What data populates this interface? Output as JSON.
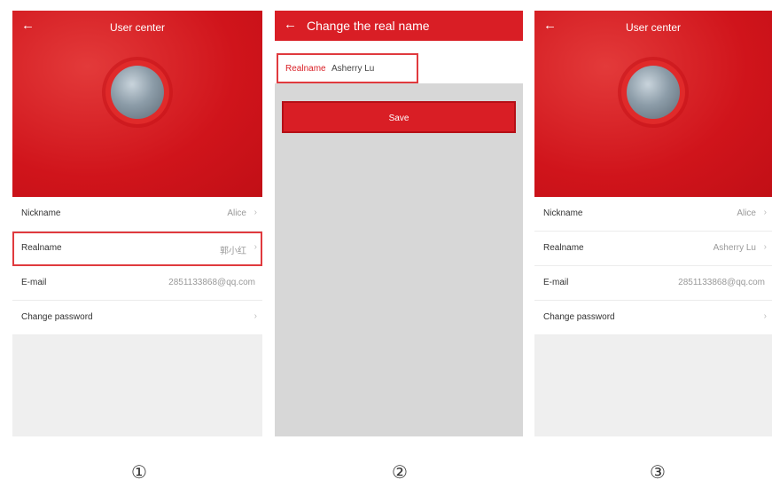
{
  "screen1": {
    "title": "User center",
    "rows": [
      {
        "label": "Nickname",
        "value": "Alice"
      },
      {
        "label": "Realname",
        "value": "郭小红"
      },
      {
        "label": "E-mail",
        "value": "2851133868@qq.com"
      },
      {
        "label": "Change password",
        "value": ""
      }
    ]
  },
  "screen2": {
    "title": "Change the real name",
    "field_label": "Realname",
    "field_value": "Asherry Lu",
    "save_label": "Save"
  },
  "screen3": {
    "title": "User center",
    "rows": [
      {
        "label": "Nickname",
        "value": "Alice"
      },
      {
        "label": "Realname",
        "value": "Asherry Lu"
      },
      {
        "label": "E-mail",
        "value": "2851133868@qq.com"
      },
      {
        "label": "Change password",
        "value": ""
      }
    ]
  },
  "step_numbers": [
    "①",
    "②",
    "③"
  ],
  "colors": {
    "primary_red": "#d91e25",
    "highlight_border": "#e03a3e"
  },
  "icons": {
    "back": "back-arrow-icon",
    "chevron": "chevron-right-icon"
  }
}
